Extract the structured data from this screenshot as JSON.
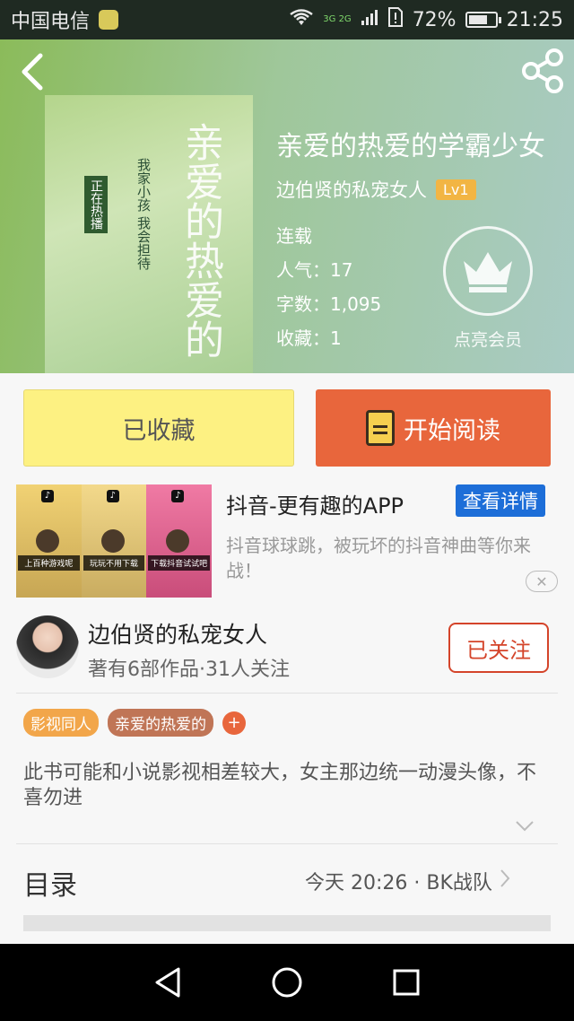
{
  "status_bar": {
    "carrier": "中国电信",
    "network": "3G 2G",
    "battery_percent": "72%",
    "battery_level": 0.72,
    "time": "21:25"
  },
  "header": {
    "back_icon": "back-arrow-icon",
    "share_icon": "share-icon",
    "cover_title_art": "亲爱的热爱的",
    "cover_sub_art": "我家小孩 我会担待",
    "cover_tag_art": "正在热播",
    "book_title": "亲爱的热爱的学霸少女",
    "author": "边伯贤的私宠女人",
    "level": "Lv1",
    "status": "连载",
    "popularity": "人气：17",
    "word_count": "字数：1,095",
    "favorites": "收藏：1",
    "vip_label": "点亮会员",
    "vip_icon": "crown-icon"
  },
  "actions": {
    "collect_label": "已收藏",
    "read_label": "开始阅读",
    "read_icon": "book-icon"
  },
  "ad": {
    "title": "抖音-更有趣的APP",
    "detail_label": "查看详情",
    "description": "抖音球球跳，被玩坏的抖音神曲等你来战！",
    "captions": [
      "上百种游戏呢",
      "玩玩不用下载",
      "下载抖音试试吧"
    ],
    "close_icon": "close-icon"
  },
  "author_section": {
    "name": "边伯贤的私宠女人",
    "meta": "著有6部作品·31人关注",
    "follow_label": "已关注"
  },
  "tags": [
    "影视同人",
    "亲爱的热爱的"
  ],
  "tag_add": "+",
  "description": "此书可能和小说影视相差较大，女主那边统一动漫头像，不喜勿进",
  "toc": {
    "label": "目录",
    "latest": "今天 20:26 · BK战队"
  },
  "colors": {
    "accent": "#e8663c",
    "collect_bg": "#fdf182",
    "follow": "#d4442a",
    "ad_button": "#1d6ed8"
  }
}
